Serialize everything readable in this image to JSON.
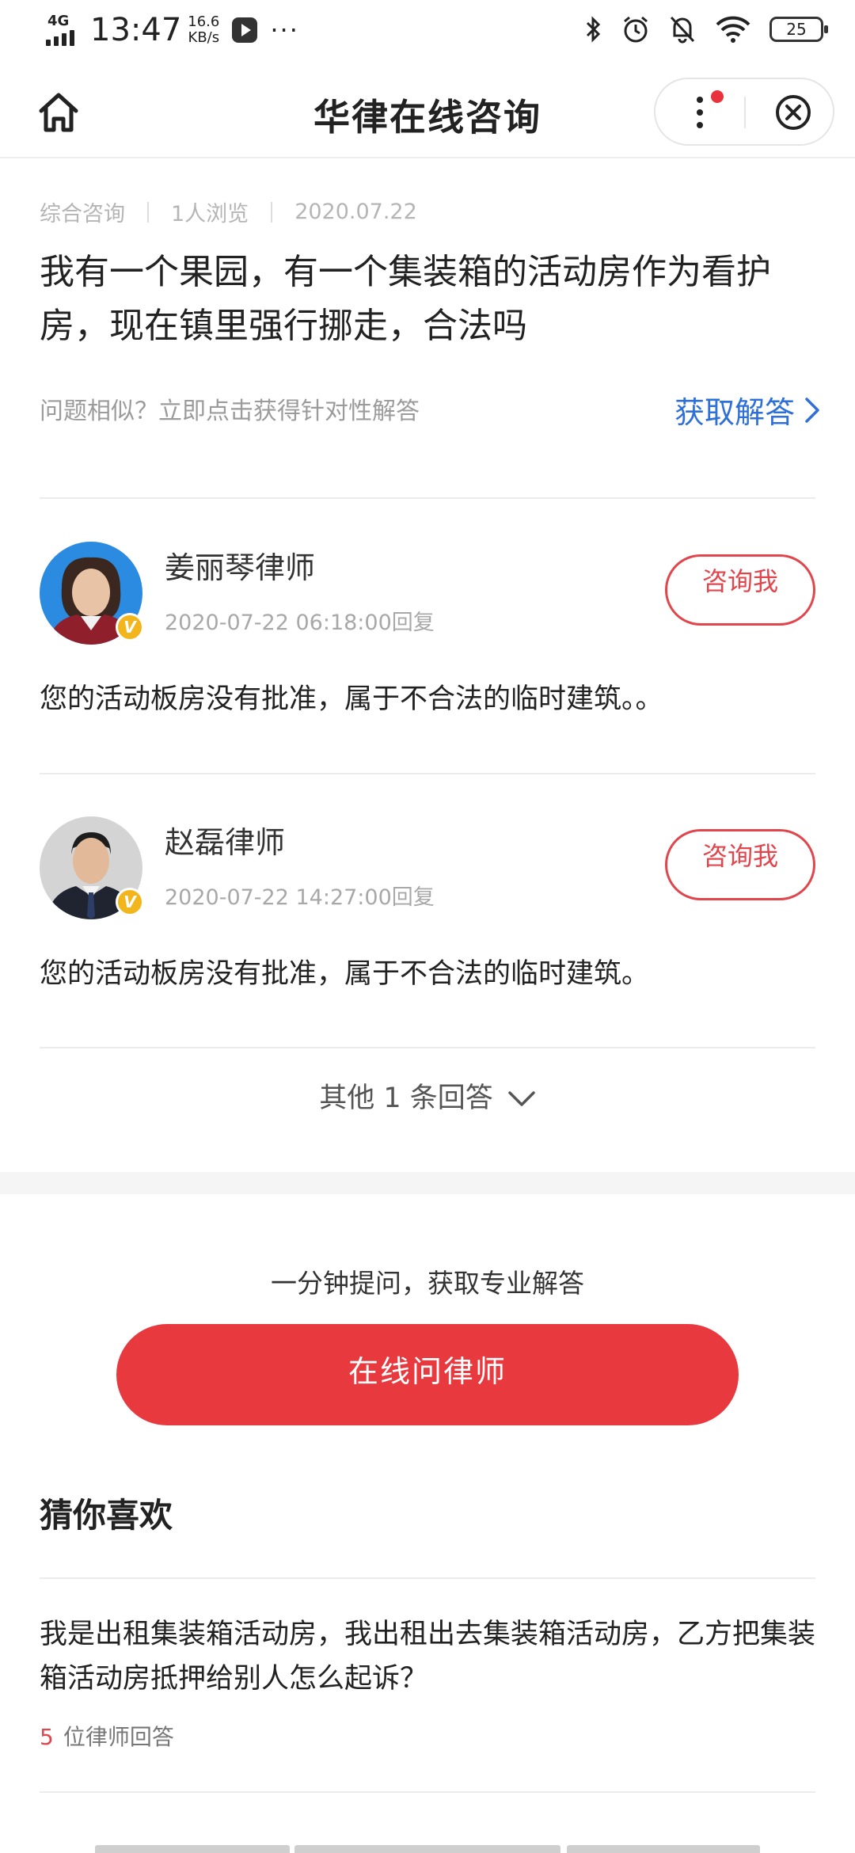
{
  "status_bar": {
    "network": "4G",
    "time": "13:47",
    "speed_value": "16.6",
    "speed_unit": "KB/s",
    "more": "···",
    "battery": "25",
    "icons": [
      "bluetooth-icon",
      "alarm-icon",
      "mute-icon",
      "wifi-icon",
      "battery-icon"
    ]
  },
  "nav": {
    "title": "华律在线咨询",
    "icons": [
      "home-icon",
      "more-menu-icon",
      "close-icon"
    ],
    "accent_dot": "#e8323e"
  },
  "question": {
    "category": "综合咨询",
    "views": "1人浏览",
    "date": "2020.07.22",
    "text": "我有一个果园，有一个集装箱的活动房作为看护房，现在镇里强行挪走，合法吗",
    "similar_prompt": "问题相似？立即点击获得针对性解答",
    "get_answer": "获取解答"
  },
  "answers": [
    {
      "name": "姜丽琴律师",
      "time": "2020-07-22 06:18:00回复",
      "button": "咨询我",
      "text": "您的活动板房没有批准，属于不合法的临时建筑。。"
    },
    {
      "name": "赵磊律师",
      "time": "2020-07-22 14:27:00回复",
      "button": "咨询我",
      "text": "您的活动板房没有批准，属于不合法的临时建筑。"
    }
  ],
  "more_answers": "其他 1 条回答",
  "cta": {
    "prompt": "一分钟提问，获取专业解答",
    "button": "在线问律师",
    "color": "#e8393f"
  },
  "recommend": {
    "title": "猜你喜欢",
    "items": [
      {
        "question": "我是出租集装箱活动房，我出租出去集装箱活动房，乙方把集装箱活动房抵押给别人怎么起诉？",
        "count": "5",
        "count_label": "位律师回答"
      }
    ]
  },
  "colors": {
    "link_blue": "#2e6fd8",
    "accent_red": "#e0464c",
    "badge_gold": "#f2b51b"
  }
}
